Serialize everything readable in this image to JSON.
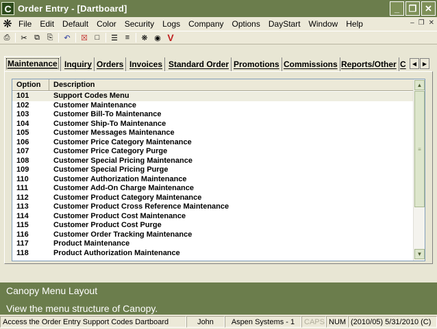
{
  "window": {
    "app_letter": "C",
    "title": "Order Entry - [Dartboard]"
  },
  "menu": [
    "File",
    "Edit",
    "Default",
    "Color",
    "Security",
    "Logs",
    "Company",
    "Options",
    "DayStart",
    "Window",
    "Help"
  ],
  "tabs": [
    "Maintenance",
    "Inquiry",
    "Orders",
    "Invoices",
    "Standard Order",
    "Promotions",
    "Commissions",
    "Reports/Other",
    "C"
  ],
  "list": {
    "headers": {
      "option": "Option",
      "description": "Description"
    },
    "rows": [
      {
        "option": "101",
        "description": "Support Codes Menu"
      },
      {
        "option": "102",
        "description": "Customer Maintenance"
      },
      {
        "option": "103",
        "description": "Customer Bill-To Maintenance"
      },
      {
        "option": "104",
        "description": "Customer Ship-To Maintenance"
      },
      {
        "option": "105",
        "description": "Customer Messages Maintenance"
      },
      {
        "option": "106",
        "description": "Customer Price Category Maintenance"
      },
      {
        "option": "107",
        "description": "Customer Price Category Purge"
      },
      {
        "option": "108",
        "description": "Customer Special Pricing Maintenance"
      },
      {
        "option": "109",
        "description": "Customer Special Pricing Purge"
      },
      {
        "option": "110",
        "description": "Customer Authorization Maintenance"
      },
      {
        "option": "111",
        "description": "Customer Add-On Charge Maintenance"
      },
      {
        "option": "112",
        "description": "Customer Product Category Maintenance"
      },
      {
        "option": "113",
        "description": "Customer Product Cross Reference Maintenance"
      },
      {
        "option": "114",
        "description": "Customer Product Cost Maintenance"
      },
      {
        "option": "115",
        "description": "Customer Product Cost Purge"
      },
      {
        "option": "116",
        "description": "Customer Order Tracking Maintenance"
      },
      {
        "option": "117",
        "description": "Product Maintenance"
      },
      {
        "option": "118",
        "description": "Product Authorization Maintenance"
      }
    ]
  },
  "info": {
    "title": "Canopy Menu Layout",
    "description": "View the menu structure of Canopy."
  },
  "status": {
    "message": "Access the Order Entry Support Codes Dartboard",
    "user": "John",
    "company": "Aspen Systems - 1",
    "caps": "CAPS",
    "num": "NUM",
    "date": "(2010/05) 5/31/2010 (C)"
  },
  "colors": {
    "titlebar": "#6b7d4c",
    "info_panel": "#6b7d4c",
    "window_bg": "#e8e6d4"
  }
}
